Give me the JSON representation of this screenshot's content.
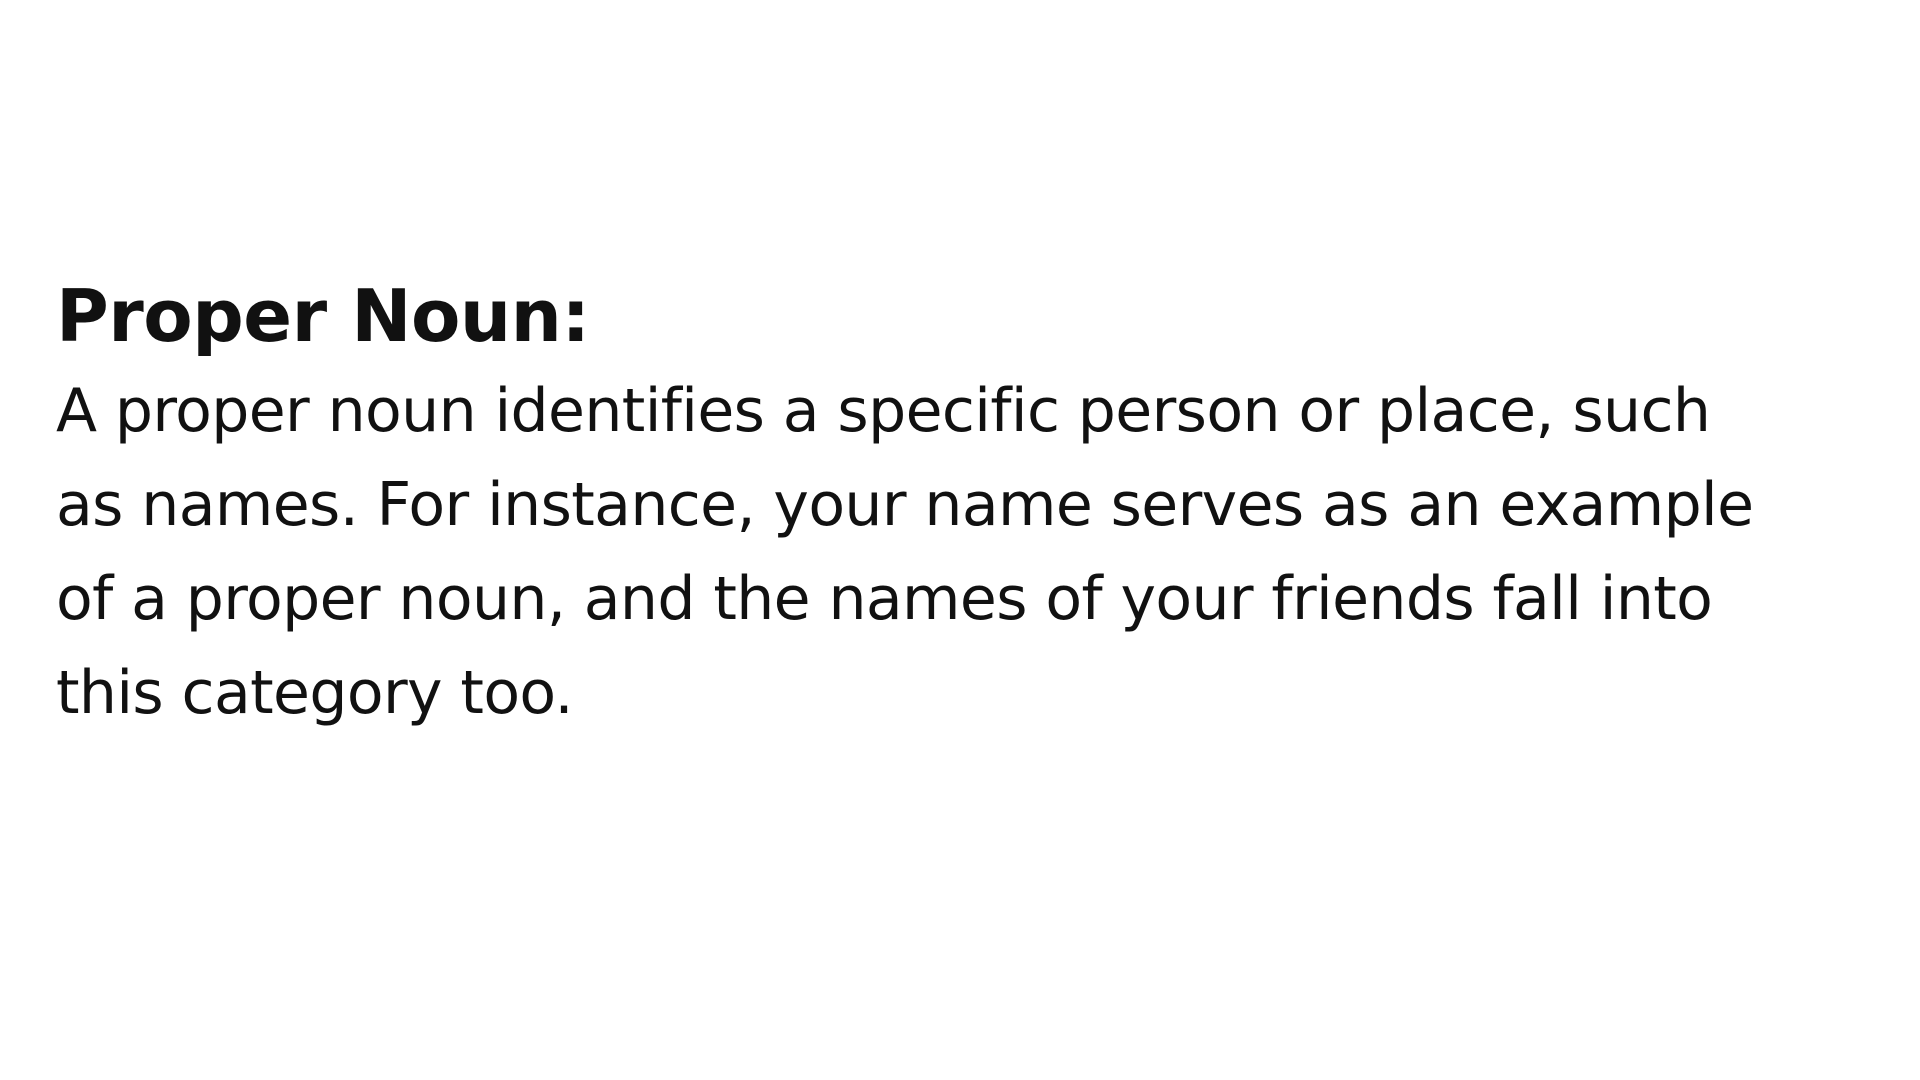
{
  "slide": {
    "heading": "Proper Noun:",
    "body_lines": [
      "A proper noun identifies a specific person or place, such",
      "as names. For instance, your name serves as an example",
      "of a proper noun, and the names of your friends fall into",
      "this category too."
    ]
  },
  "colors": {
    "background": "#ffffff",
    "text": "#111111"
  }
}
